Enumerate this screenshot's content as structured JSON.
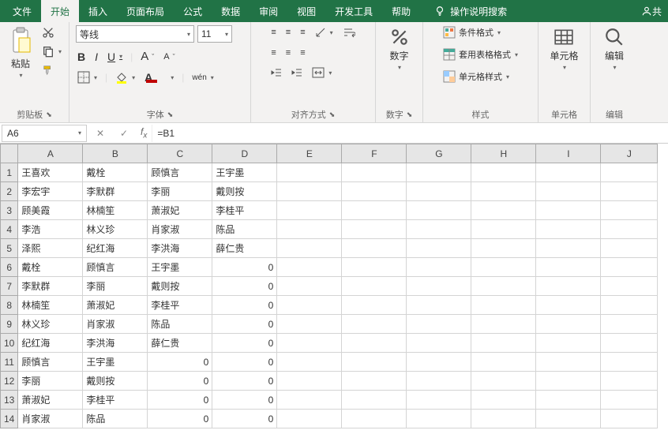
{
  "tabs": {
    "file": "文件",
    "home": "开始",
    "insert": "插入",
    "layout": "页面布局",
    "formulas": "公式",
    "data": "数据",
    "review": "审阅",
    "view": "视图",
    "dev": "开发工具",
    "help": "帮助",
    "tell": "操作说明搜索",
    "share": "共"
  },
  "groups": {
    "clipboard": "剪贴板",
    "font": "字体",
    "align": "对齐方式",
    "number": "数字",
    "styles": "样式",
    "cells": "单元格",
    "editing": "编辑"
  },
  "clipboard": {
    "paste": "粘贴"
  },
  "font": {
    "name": "等线",
    "size": "11",
    "increase": "A",
    "decrease": "A",
    "bold": "B",
    "italic": "I",
    "underline": "U",
    "phonetic": "wén"
  },
  "number": {
    "label": "数字"
  },
  "styles_items": {
    "cond": "条件格式",
    "table": "套用表格格式",
    "cell": "单元格样式"
  },
  "cells": {
    "label": "单元格"
  },
  "editing": {
    "label": "编辑"
  },
  "namebox": "A6",
  "formula": "=B1",
  "cols": [
    "A",
    "B",
    "C",
    "D",
    "E",
    "F",
    "G",
    "H",
    "I",
    "J"
  ],
  "rows": [
    {
      "r": "1",
      "c": [
        "王喜欢",
        "戴栓",
        "顾慎言",
        "王宇墨",
        "",
        "",
        "",
        "",
        "",
        ""
      ]
    },
    {
      "r": "2",
      "c": [
        "李宏宇",
        "李默群",
        "李丽",
        "戴则按",
        "",
        "",
        "",
        "",
        "",
        ""
      ]
    },
    {
      "r": "3",
      "c": [
        "顾美霞",
        "林楠笙",
        "萧淑妃",
        "李桂平",
        "",
        "",
        "",
        "",
        "",
        ""
      ]
    },
    {
      "r": "4",
      "c": [
        "李浩",
        "林义珍",
        "肖家淑",
        "陈品",
        "",
        "",
        "",
        "",
        "",
        ""
      ]
    },
    {
      "r": "5",
      "c": [
        "泽熙",
        "纪红海",
        "李洪海",
        "薛仁贵",
        "",
        "",
        "",
        "",
        "",
        ""
      ]
    },
    {
      "r": "6",
      "c": [
        "戴栓",
        "顾慎言",
        "王宇墨",
        "0",
        "",
        "",
        "",
        "",
        "",
        ""
      ]
    },
    {
      "r": "7",
      "c": [
        "李默群",
        "李丽",
        "戴则按",
        "0",
        "",
        "",
        "",
        "",
        "",
        ""
      ]
    },
    {
      "r": "8",
      "c": [
        "林楠笙",
        "萧淑妃",
        "李桂平",
        "0",
        "",
        "",
        "",
        "",
        "",
        ""
      ]
    },
    {
      "r": "9",
      "c": [
        "林义珍",
        "肖家淑",
        "陈品",
        "0",
        "",
        "",
        "",
        "",
        "",
        ""
      ]
    },
    {
      "r": "10",
      "c": [
        "纪红海",
        "李洪海",
        "薛仁贵",
        "0",
        "",
        "",
        "",
        "",
        "",
        ""
      ]
    },
    {
      "r": "11",
      "c": [
        "顾慎言",
        "王宇墨",
        "0",
        "0",
        "",
        "",
        "",
        "",
        "",
        ""
      ]
    },
    {
      "r": "12",
      "c": [
        "李丽",
        "戴则按",
        "0",
        "0",
        "",
        "",
        "",
        "",
        "",
        ""
      ]
    },
    {
      "r": "13",
      "c": [
        "萧淑妃",
        "李桂平",
        "0",
        "0",
        "",
        "",
        "",
        "",
        "",
        ""
      ]
    },
    {
      "r": "14",
      "c": [
        "肖家淑",
        "陈品",
        "0",
        "0",
        "",
        "",
        "",
        "",
        "",
        ""
      ]
    }
  ]
}
